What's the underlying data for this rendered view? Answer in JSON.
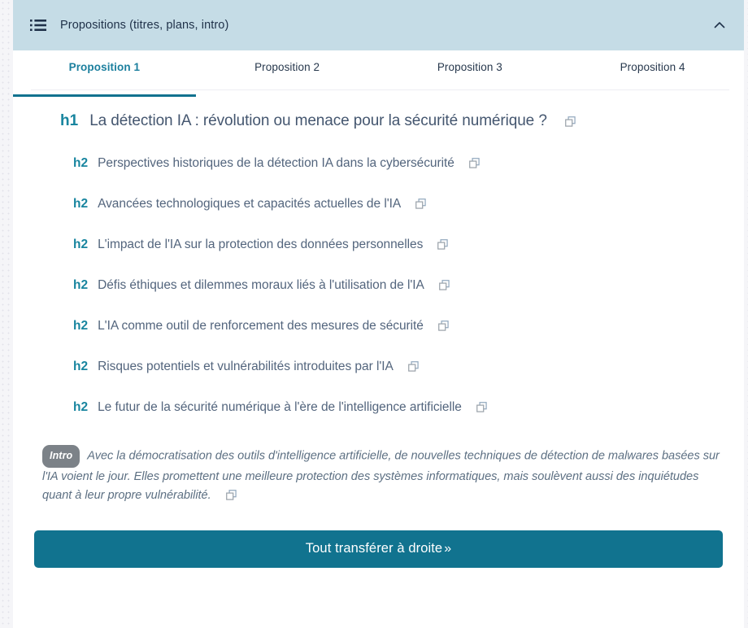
{
  "panel": {
    "title": "Propositions (titres, plans, intro)",
    "list_icon": "list-icon",
    "collapse_icon": "chevron-up-icon",
    "header_bg": "#c5dce6"
  },
  "tabs": {
    "active_index": 0,
    "items": [
      {
        "label": "Proposition 1"
      },
      {
        "label": "Proposition 2"
      },
      {
        "label": "Proposition 3"
      },
      {
        "label": "Proposition 4"
      }
    ],
    "active_color": "#1b7f9e",
    "inactive_color": "#27384d"
  },
  "outline": {
    "h1": {
      "tag": "h1",
      "text": "La détection IA : révolution ou menace pour la sécurité numérique ?",
      "copy_icon": "copy-icon"
    },
    "h2_items": [
      {
        "tag": "h2",
        "text": "Perspectives historiques de la détection IA dans la cybersécurité",
        "copy_icon": "copy-icon"
      },
      {
        "tag": "h2",
        "text": "Avancées technologiques et capacités actuelles de l'IA",
        "copy_icon": "copy-icon"
      },
      {
        "tag": "h2",
        "text": "L'impact de l'IA sur la protection des données personnelles",
        "copy_icon": "copy-icon"
      },
      {
        "tag": "h2",
        "text": "Défis éthiques et dilemmes moraux liés à l'utilisation de l'IA",
        "copy_icon": "copy-icon"
      },
      {
        "tag": "h2",
        "text": "L'IA comme outil de renforcement des mesures de sécurité",
        "copy_icon": "copy-icon"
      },
      {
        "tag": "h2",
        "text": "Risques potentiels et vulnérabilités introduites par l'IA",
        "copy_icon": "copy-icon"
      },
      {
        "tag": "h2",
        "text": "Le futur de la sécurité numérique à l'ère de l'intelligence artificielle",
        "copy_icon": "copy-icon"
      }
    ],
    "tag_color": "#18859f",
    "heading_color": "#53657d"
  },
  "intro": {
    "badge": "Intro",
    "text": "Avec la démocratisation des outils d'intelligence artificielle, de nouvelles techniques de détection de malwares basées sur l'IA voient le jour. Elles promettent une meilleure protection des systèmes informatiques, mais soulèvent aussi des inquiétudes quant à leur propre vulnérabilité.",
    "copy_icon": "copy-icon",
    "badge_bg": "#7c8288"
  },
  "footer": {
    "transfer_label": "Tout transférer à droite",
    "transfer_chevron": "»",
    "button_color": "#11738f"
  }
}
